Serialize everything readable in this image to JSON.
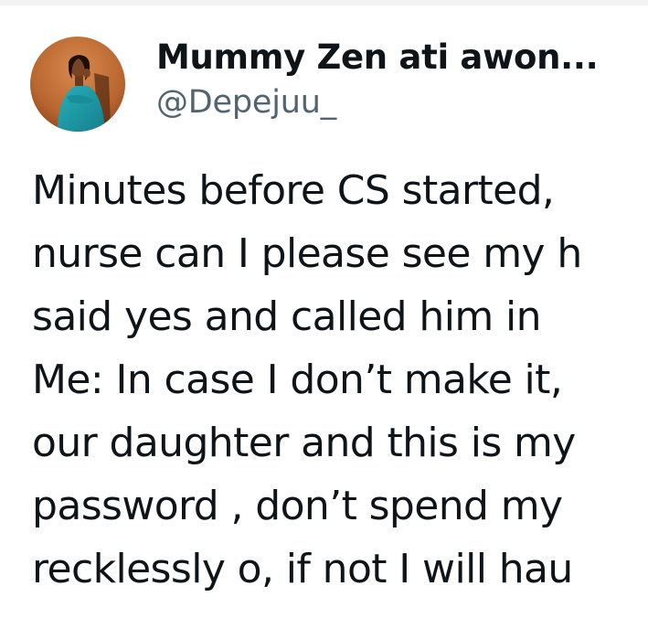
{
  "tweet": {
    "author": {
      "display_name": "Mummy Zen ati awon...",
      "handle": "@Depejuu_",
      "avatar_icon": "profile-photo-avatar"
    },
    "text_lines": [
      "Minutes before CS started,",
      "nurse can I please see my h",
      "said yes and called him in",
      "Me: In case I don’t make it,",
      "our daughter and this is my",
      "password , don’t spend my",
      "recklessly o, if not I will hau"
    ]
  },
  "colors": {
    "text_primary": "#0f1419",
    "text_secondary": "#536471",
    "background": "#ffffff",
    "avatar_background": "#b8652f",
    "avatar_dress": "#1e9aa6"
  }
}
